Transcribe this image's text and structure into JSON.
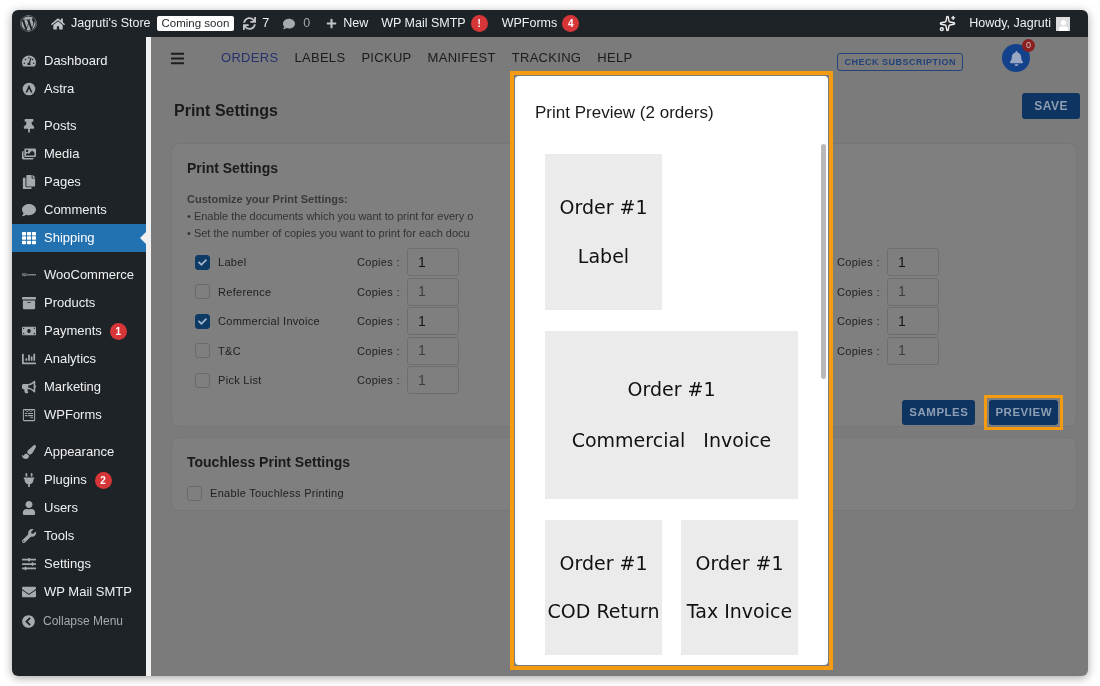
{
  "admin_bar": {
    "site": "Jagruti's Store",
    "status_badge": "Coming soon",
    "updates": "7",
    "comments": "0",
    "new": "New",
    "items": [
      {
        "label": "WP Mail SMTP",
        "badge": "!"
      },
      {
        "label": "WPForms",
        "badge": "4"
      }
    ],
    "greeting": "Howdy, Jagruti"
  },
  "sidebar": {
    "groups": [
      [
        {
          "label": "Dashboard",
          "selected": false
        },
        {
          "label": "Astra",
          "selected": false
        }
      ],
      [
        {
          "label": "Posts",
          "selected": false
        },
        {
          "label": "Media",
          "selected": false
        },
        {
          "label": "Pages",
          "selected": false
        },
        {
          "label": "Comments",
          "selected": false
        },
        {
          "label": "Shipping",
          "selected": true
        }
      ],
      [
        {
          "label": "WooCommerce",
          "selected": false
        },
        {
          "label": "Products",
          "selected": false
        },
        {
          "label": "Payments",
          "selected": false,
          "badge": "1"
        },
        {
          "label": "Analytics",
          "selected": false
        },
        {
          "label": "Marketing",
          "selected": false
        },
        {
          "label": "WPForms",
          "selected": false
        }
      ],
      [
        {
          "label": "Appearance",
          "selected": false
        },
        {
          "label": "Plugins",
          "selected": false,
          "badge": "2"
        },
        {
          "label": "Users",
          "selected": false
        },
        {
          "label": "Tools",
          "selected": false
        },
        {
          "label": "Settings",
          "selected": false
        },
        {
          "label": "WP Mail SMTP",
          "selected": false
        }
      ]
    ],
    "collapse": "Collapse Menu"
  },
  "nav": {
    "tabs": [
      {
        "label": "ORDERS",
        "selected": true
      },
      {
        "label": "LABELS",
        "selected": false
      },
      {
        "label": "PICKUP",
        "selected": false
      },
      {
        "label": "MANIFEST",
        "selected": false
      },
      {
        "label": "TRACKING",
        "selected": false
      },
      {
        "label": "HELP",
        "selected": false
      }
    ],
    "subscription_button": "CHECK SUBSCRIPTION",
    "notification_count": "0"
  },
  "page_title": "Print Settings",
  "save_button": "SAVE",
  "print_settings": {
    "title": "Print Settings",
    "intro": "Customize your Print Settings:",
    "bullets": [
      "• Enable the documents which you want to print for every o",
      "• Set the number of copies you want to print for each docu"
    ],
    "documents": [
      {
        "label": "Label",
        "checked": true,
        "copies_label": "Copies :",
        "copies": "1"
      },
      {
        "label": "Reference",
        "checked": false,
        "copies_label": "Copies :",
        "copies": "1"
      },
      {
        "label": "Commercial Invoice",
        "checked": true,
        "copies_label": "Copies :",
        "copies": "1"
      },
      {
        "label": "T&C",
        "checked": false,
        "copies_label": "Copies :",
        "copies": "1"
      },
      {
        "label": "Pick List",
        "checked": false,
        "copies_label": "Copies :",
        "copies": "1"
      }
    ],
    "right_column": [
      {
        "copies_label": "Copies :",
        "copies": "1",
        "enabled": true
      },
      {
        "copies_label": "Copies :",
        "copies": "1",
        "enabled": false
      },
      {
        "copies_label": "Copies :",
        "copies": "1",
        "enabled": true
      },
      {
        "copies_label": "Copies :",
        "copies": "1",
        "enabled": false
      }
    ],
    "buttons": [
      "SAMPLES",
      "PREVIEW"
    ]
  },
  "touchless": {
    "title": "Touchless Print Settings",
    "option": {
      "label": "Enable Touchless Printing",
      "checked": false
    }
  },
  "modal": {
    "title": "Print Preview (2 orders)",
    "pages": [
      {
        "kind": "narrow",
        "order": "Order #1",
        "document": "Label"
      },
      {
        "kind": "wide",
        "order": "Order #1",
        "document": "Commercial Invoice"
      },
      {
        "kind": "narrow",
        "order": "Order #1",
        "document": "COD Return"
      },
      {
        "kind": "narrow",
        "order": "Order #1",
        "document": "Tax Invoice"
      }
    ]
  }
}
